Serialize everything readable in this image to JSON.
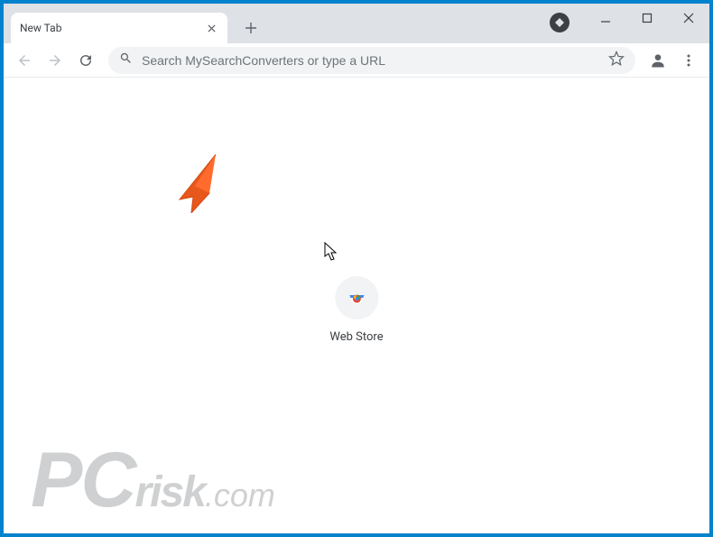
{
  "tab": {
    "title": "New Tab"
  },
  "omnibox": {
    "placeholder": "Search MySearchConverters or type a URL"
  },
  "shortcut": {
    "label": "Web Store"
  },
  "watermark": {
    "p": "P",
    "c": "C",
    "risk": "risk",
    "dom": ".com"
  },
  "icons": {
    "close": "close-icon",
    "plus": "plus-icon",
    "ext": "extension-badge-icon",
    "min": "minimize-icon",
    "max": "maximize-icon",
    "winclose": "window-close-icon",
    "back": "back-arrow-icon",
    "forward": "forward-arrow-icon",
    "reload": "reload-icon",
    "search": "search-icon",
    "star": "bookmark-star-icon",
    "profile": "profile-icon",
    "menu": "kebab-menu-icon",
    "webstore": "chrome-webstore-icon"
  }
}
